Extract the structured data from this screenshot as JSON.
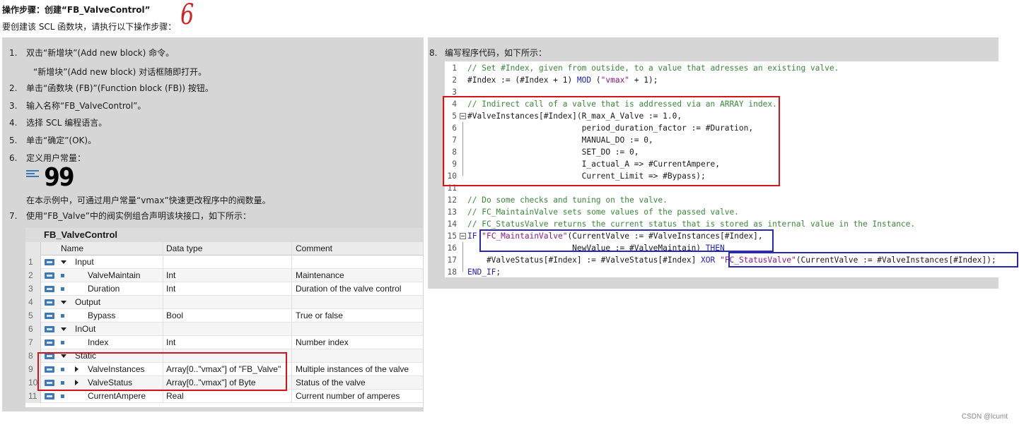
{
  "header": {
    "title": "操作步骤：创建“FB_ValveControl”",
    "subtitle": "要创建该 SCL 函数块，请执行以下操作步骤：",
    "annotation_6": "6"
  },
  "steps": [
    {
      "num": "1.",
      "text": "双击“新增块”(Add new block) 命令。"
    },
    {
      "sub": "“新增块”(Add new block) 对话框随即打开。"
    },
    {
      "num": "2.",
      "text": "单击“函数块 (FB)”(Function block (FB)) 按钮。"
    },
    {
      "num": "3.",
      "text": "输入名称“FB_ValveControl”。"
    },
    {
      "num": "4.",
      "text": "选择 SCL 编程语言。"
    },
    {
      "num": "5.",
      "text": "单击“确定”(OK)。"
    },
    {
      "num": "6.",
      "text": "定义用户常量："
    },
    {
      "sub": "在本示例中，可通过用户常量“vmax”快速更改程序中的阀数量。"
    },
    {
      "num": "7.",
      "text": "使用“FB_Valve”中的阀实例组合声明该块接口，如下所示："
    }
  ],
  "annotation_99": "99",
  "interface_table": {
    "title": "FB_ValveControl",
    "headers": {
      "name": "Name",
      "type": "Data type",
      "comment": "Comment"
    },
    "rows": [
      {
        "num": "1",
        "name": "Input",
        "type": "",
        "comment": "",
        "level": "section"
      },
      {
        "num": "2",
        "name": "ValveMaintain",
        "type": "Int",
        "comment": "Maintenance",
        "level": "item"
      },
      {
        "num": "3",
        "name": "Duration",
        "type": "Int",
        "comment": "Duration of the valve control",
        "level": "item"
      },
      {
        "num": "4",
        "name": "Output",
        "type": "",
        "comment": "",
        "level": "section"
      },
      {
        "num": "5",
        "name": "Bypass",
        "type": "Bool",
        "comment": "True or false",
        "level": "item"
      },
      {
        "num": "6",
        "name": "InOut",
        "type": "",
        "comment": "",
        "level": "section"
      },
      {
        "num": "7",
        "name": "Index",
        "type": "Int",
        "comment": "Number index",
        "level": "item"
      },
      {
        "num": "8",
        "name": "Static",
        "type": "",
        "comment": "",
        "level": "section"
      },
      {
        "num": "9",
        "name": "ValveInstances",
        "type": "Array[0..\"vmax\"] of \"FB_Valve\"",
        "comment": "Multiple instances of the valve",
        "level": "array"
      },
      {
        "num": "10",
        "name": "ValveStatus",
        "type": "Array[0..\"vmax\"] of Byte",
        "comment": "Status of the valve",
        "level": "array"
      },
      {
        "num": "11",
        "name": "CurrentAmpere",
        "type": "Real",
        "comment": "Current number of amperes",
        "level": "item"
      }
    ]
  },
  "step8": {
    "num": "8.",
    "text": "编写程序代码，如下所示："
  },
  "code_lines": [
    {
      "n": "1",
      "text": "// Set #Index, given from outside, to a value that adresses an existing valve."
    },
    {
      "n": "2",
      "text": "#Index := (#Index + 1) MOD (\"vmax\" + 1);"
    },
    {
      "n": "3",
      "text": ""
    },
    {
      "n": "4",
      "text": "// Indirect call of a valve that is addressed via an ARRAY index."
    },
    {
      "n": "5",
      "text": "#ValveInstances[#Index](R_max_A_Valve := 1.0,"
    },
    {
      "n": "6",
      "text": "                        period_duration_factor := #Duration,"
    },
    {
      "n": "7",
      "text": "                        MANUAL_DO := 0,"
    },
    {
      "n": "8",
      "text": "                        SET_DO := 0,"
    },
    {
      "n": "9",
      "text": "                        I_actual_A => #CurrentAmpere,"
    },
    {
      "n": "10",
      "text": "                        Current_Limit => #Bypass);"
    },
    {
      "n": "11",
      "text": ""
    },
    {
      "n": "12",
      "text": "// Do some checks and tuning on the valve."
    },
    {
      "n": "13",
      "text": "// FC_MaintainValve sets some values of the passed valve."
    },
    {
      "n": "14",
      "text": "// FC_StatusValve returns the current status that is stored as internal value in the Instance."
    },
    {
      "n": "15",
      "text": "IF \"FC_MaintainValve\"(CurrentValve := #ValveInstances[#Index],"
    },
    {
      "n": "16",
      "text": "                      NewValue := #ValveMaintain) THEN"
    },
    {
      "n": "17",
      "text": "    #ValveStatus[#Index] := #ValveStatus[#Index] XOR \"FC_StatusValve\"(CurrentValve := #ValveInstances[#Index]);"
    },
    {
      "n": "18",
      "text": "END_IF;"
    }
  ],
  "footer": "CSDN @lcumt",
  "colors": {
    "red_box": "#d4141c",
    "blue_box": "#2828b8",
    "comment_green": "#3a8a3a",
    "panel_gray": "#d6d6d6"
  }
}
